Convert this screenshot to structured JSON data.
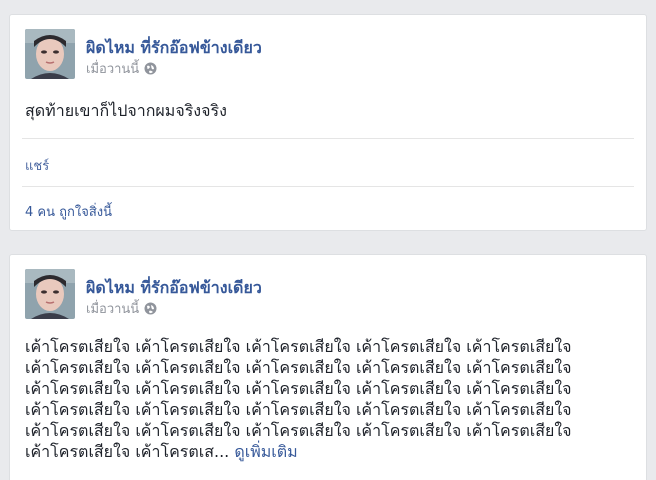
{
  "posts": [
    {
      "author": "ผิดไหม ที่รักอ๊อฟข้างเดียว",
      "time": "เมื่อวานนี้",
      "privacy_icon": "globe-icon",
      "text": "สุดท้ายเขาก็ไปจากผมจริงจริง",
      "share_label": "แชร์",
      "likes_text": "4 คน ถูกใจสิ่งนี้"
    },
    {
      "author": "ผิดไหม ที่รักอ๊อฟข้างเดียว",
      "time": "เมื่อวานนี้",
      "privacy_icon": "globe-icon",
      "lines": [
        "เค้าโครตเสียใจ เค้าโครตเสียใจ เค้าโครตเสียใจ เค้าโครตเสียใจ เค้าโครตเสียใจ",
        "เค้าโครตเสียใจ เค้าโครตเสียใจ เค้าโครตเสียใจ เค้าโครตเสียใจ เค้าโครตเสียใจ",
        "เค้าโครตเสียใจ เค้าโครตเสียใจ เค้าโครตเสียใจ เค้าโครตเสียใจ เค้าโครตเสียใจ",
        "เค้าโครตเสียใจ เค้าโครตเสียใจ เค้าโครตเสียใจ เค้าโครตเสียใจ เค้าโครตเสียใจ",
        "เค้าโครตเสียใจ เค้าโครตเสียใจ เค้าโครตเสียใจ เค้าโครตเสียใจ เค้าโครตเสียใจ"
      ],
      "last_line": "เค้าโครตเสียใจ เค้าโครตเส...",
      "see_more": "ดูเพิ่มเติม"
    }
  ]
}
